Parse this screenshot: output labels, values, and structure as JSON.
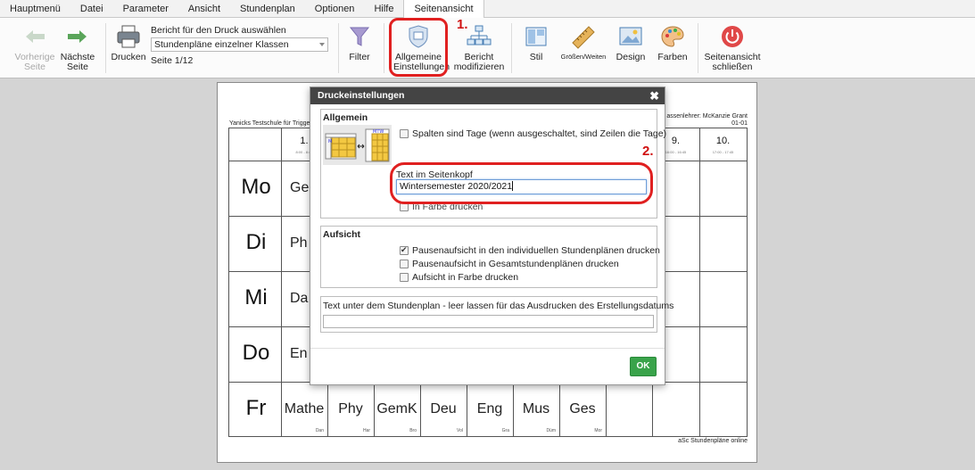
{
  "menu": {
    "items": [
      "Hauptmenü",
      "Datei",
      "Parameter",
      "Ansicht",
      "Stundenplan",
      "Optionen",
      "Hilfe",
      "Seitenansicht"
    ],
    "active_index": 7
  },
  "ribbon": {
    "prev_page": "Vorherige Seite",
    "next_page": "Nächste Seite",
    "print": "Drucken",
    "report_label": "Bericht für den Druck auswählen",
    "report_selected": "Stundenpläne einzelner Klassen",
    "page_indicator": "Seite 1/12",
    "filter": "Filter",
    "general_settings": "Allgemeine Einstellungen",
    "modify_report": "Bericht modifizieren",
    "style": "Stil",
    "sizes": "Größen/Weiten",
    "design": "Design",
    "colors": "Farben",
    "close_preview": "Seitenansicht schließen"
  },
  "annotations": {
    "step1": "1.",
    "step2": "2."
  },
  "background_page": {
    "school": "Yanicks Testschule für Trigge",
    "teacher_line1": "assenlehrer: McKanzie Grant",
    "teacher_line2": "01-01",
    "footer": "aSc Stundenpläne online",
    "days": [
      "Mo",
      "Di",
      "Mi",
      "Do",
      "Fr"
    ],
    "periods": [
      {
        "num": "1.",
        "time": "8:00 - 8:45"
      },
      {
        "num": "9.",
        "time": "16:00 - 16:45"
      },
      {
        "num": "10.",
        "time": "17:00 - 17:45"
      }
    ],
    "row_first_subjects": [
      "Ge",
      "Ph",
      "Da",
      "En"
    ],
    "friday": [
      {
        "subject": "Mathe",
        "teacher": "Dan"
      },
      {
        "subject": "Phy",
        "teacher": "Har"
      },
      {
        "subject": "GemK",
        "teacher": "Bro"
      },
      {
        "subject": "Deu",
        "teacher": "Vol"
      },
      {
        "subject": "Eng",
        "teacher": "Gra"
      },
      {
        "subject": "Mus",
        "teacher": "Düm"
      },
      {
        "subject": "Ges",
        "teacher": "Mor"
      }
    ]
  },
  "dialog": {
    "title": "Druckeinstellungen",
    "close": "✖",
    "general": {
      "title": "Allgemein",
      "columns_are_days": {
        "label": "Spalten sind Tage (wenn ausgeschaltet, sind Zeilen die Tage)",
        "checked": false
      },
      "header_text_label": "Text im Seitenkopf",
      "header_text_value": "Wintersemester 2020/2021",
      "print_in_color": {
        "label": "In Farbe drucken",
        "checked": false
      }
    },
    "supervision": {
      "title": "Aufsicht",
      "options": [
        {
          "label": "Pausenaufsicht in den individuellen Stundenplänen drucken",
          "checked": true
        },
        {
          "label": "Pausenaufsicht in Gesamtstundenplänen drucken",
          "checked": false
        },
        {
          "label": "Aufsicht in Farbe drucken",
          "checked": false
        }
      ]
    },
    "footer_text": {
      "label": "Text unter dem Stundenplan - leer lassen für das Ausdrucken des Erstellungsdatums",
      "value": ""
    },
    "ok": "OK"
  }
}
